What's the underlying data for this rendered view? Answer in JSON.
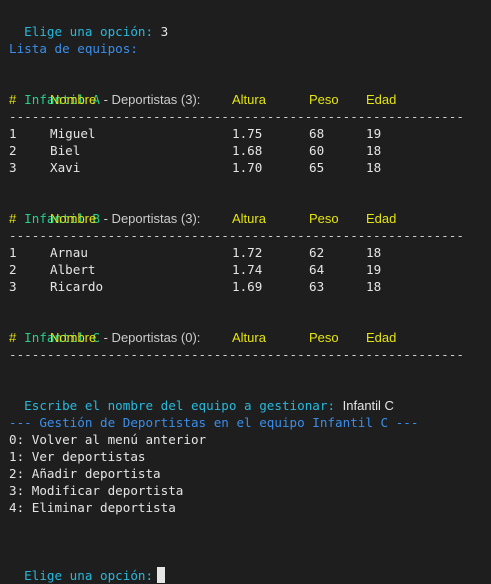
{
  "prompt1": {
    "label": "Elige una opción:",
    "value": "3"
  },
  "list_title": "Lista de equipos:",
  "columns": {
    "num": "#",
    "name": "Nombre",
    "altura": "Altura",
    "peso": "Peso",
    "edad": "Edad"
  },
  "separator": "---------------------------------------------------------------",
  "teams": [
    {
      "name": "Infantil A",
      "suffix": " - Deportistas (3):",
      "rows": [
        {
          "num": "1",
          "name": "Miguel",
          "altura": "1.75",
          "peso": "68",
          "edad": "19"
        },
        {
          "num": "2",
          "name": "Biel",
          "altura": "1.68",
          "peso": "60",
          "edad": "18"
        },
        {
          "num": "3",
          "name": "Xavi",
          "altura": "1.70",
          "peso": "65",
          "edad": "18"
        }
      ]
    },
    {
      "name": "Infantil B",
      "suffix": " - Deportistas (3):",
      "rows": [
        {
          "num": "1",
          "name": "Arnau",
          "altura": "1.72",
          "peso": "62",
          "edad": "18"
        },
        {
          "num": "2",
          "name": "Albert",
          "altura": "1.74",
          "peso": "64",
          "edad": "19"
        },
        {
          "num": "3",
          "name": "Ricardo",
          "altura": "1.69",
          "peso": "63",
          "edad": "18"
        }
      ]
    },
    {
      "name": "Infantil C",
      "suffix": " - Deportistas (0):",
      "rows": []
    }
  ],
  "manage_prompt": {
    "label": "Escribe el nombre del equipo a gestionar:",
    "value": "Infantil C"
  },
  "submenu_title": "--- Gestión de Deportistas en el equipo Infantil C ---",
  "submenu_options": [
    "0: Volver al menú anterior",
    "1: Ver deportistas",
    "2: Añadir deportista",
    "3: Modificar deportista",
    "4: Eliminar deportista"
  ],
  "prompt2": {
    "label": "Elige una opción:",
    "value": ""
  },
  "colors": {
    "background": "#1e1e1e",
    "cyan": "#29b8db",
    "blue": "#3b8eea",
    "green": "#23d18b",
    "yellow": "#e5e510",
    "text": "#cccccc"
  }
}
